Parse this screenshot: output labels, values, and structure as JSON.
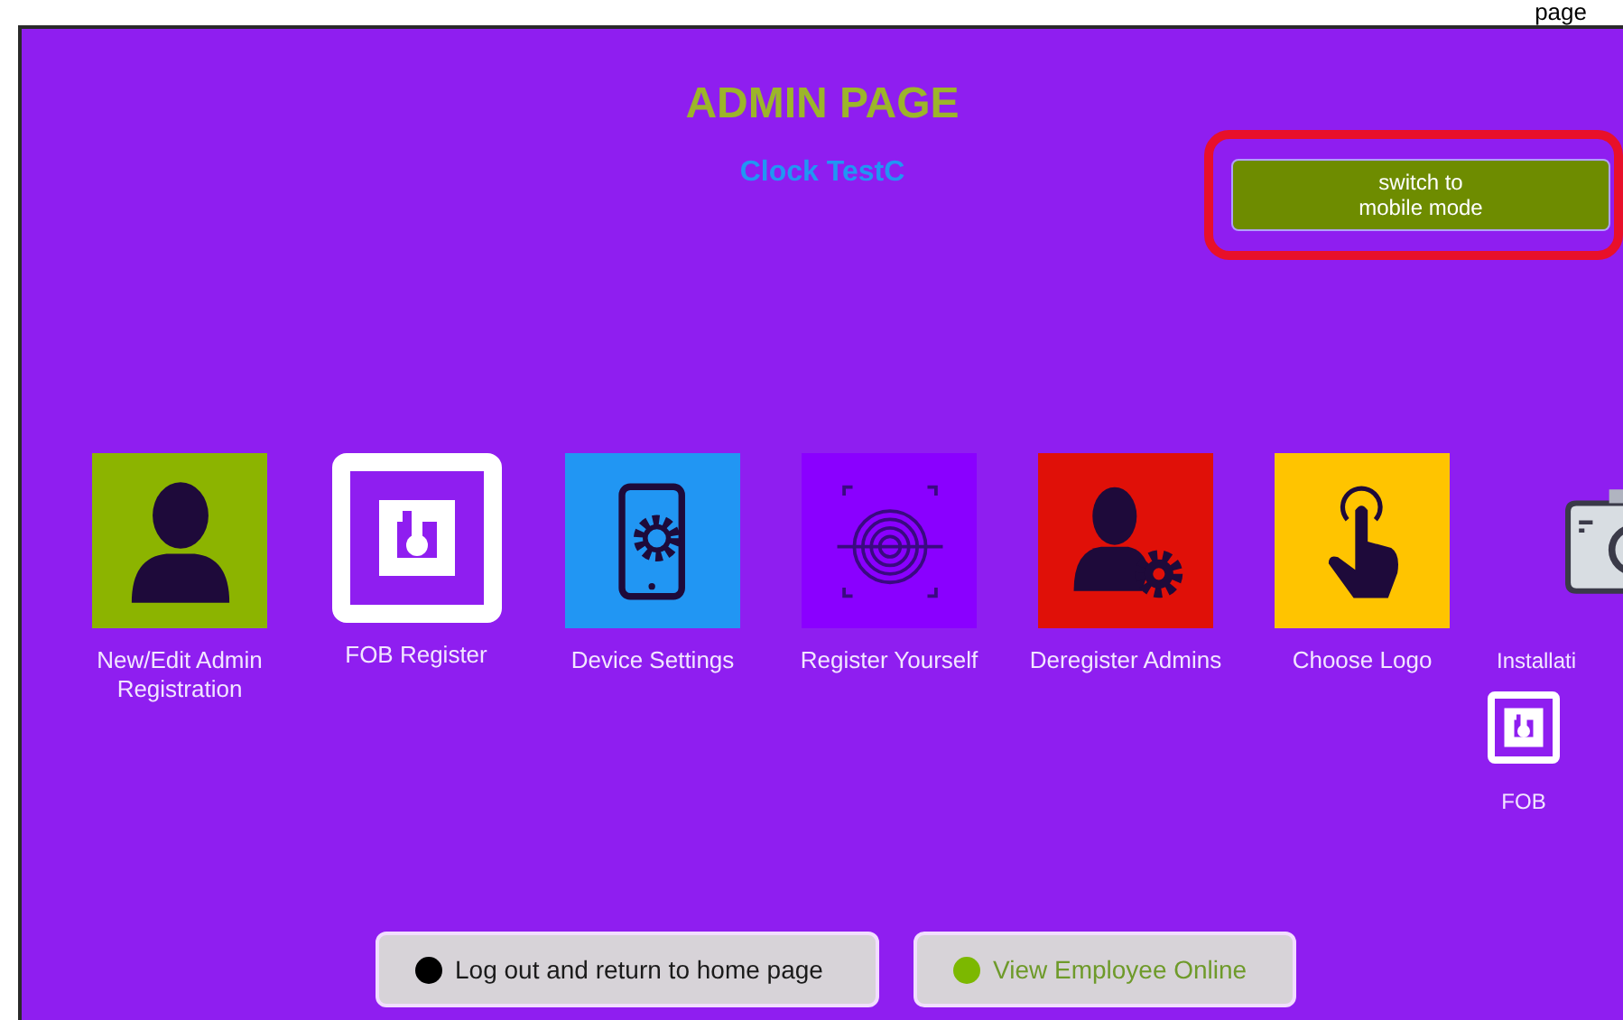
{
  "top_strip": {
    "text": "page"
  },
  "header": {
    "title": "ADMIN PAGE",
    "subtitle": "Clock TestC"
  },
  "mode_button": {
    "label": "switch to mobile mode",
    "highlighted": true
  },
  "tiles": [
    {
      "kind": "person",
      "label": "New/Edit Admin Registration",
      "color": "#8cb400"
    },
    {
      "kind": "fob",
      "label": "FOB Register",
      "color": "#ffffff"
    },
    {
      "kind": "device",
      "label": "Device Settings",
      "color": "#2196f3"
    },
    {
      "kind": "fingerprint",
      "label": "Register Yourself",
      "color": "#8a00ff"
    },
    {
      "kind": "person-gear",
      "label": "Deregister Admins",
      "color": "#e01008"
    },
    {
      "kind": "hand",
      "label": "Choose Logo",
      "color": "#ffc400"
    },
    {
      "kind": "camera",
      "label": "Installati",
      "color": "#8f1ef0"
    }
  ],
  "fob_shortcut": {
    "label": "FOB"
  },
  "bottom_buttons": [
    {
      "label": "Log out and return to home page",
      "color": "#000000"
    },
    {
      "label": "View Employee Online",
      "color": "#7cb800"
    }
  ]
}
